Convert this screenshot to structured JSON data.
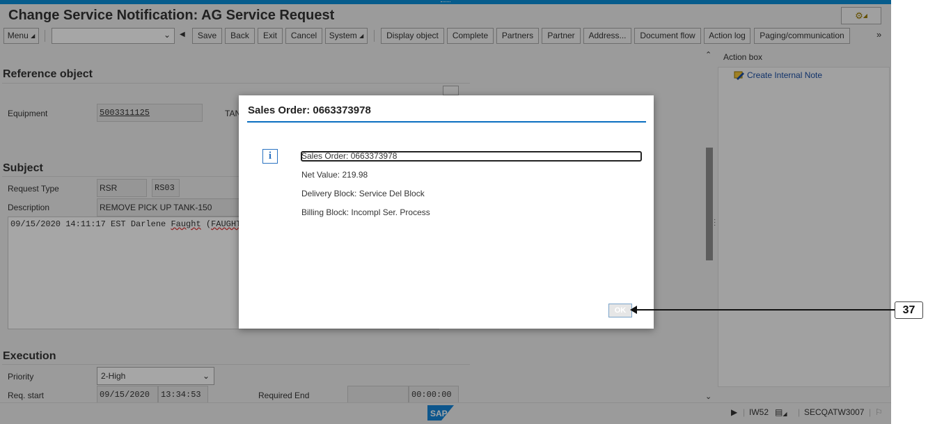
{
  "window": {
    "title": "Change Service Notification: AG Service Request"
  },
  "toolbar": {
    "menu_label": "Menu",
    "command_field_value": "",
    "save_label": "Save",
    "back_label": "Back",
    "exit_label": "Exit",
    "cancel_label": "Cancel",
    "system_label": "System",
    "display_object_label": "Display object",
    "complete_label": "Complete",
    "partners_label": "Partners",
    "partner_label": "Partner",
    "address_label": "Address...",
    "document_flow_label": "Document flow",
    "action_log_label": "Action log",
    "paging_label": "Paging/communication",
    "more_label": "»"
  },
  "reference_object": {
    "heading": "Reference object",
    "equipment_label": "Equipment",
    "equipment_value": "5003311125",
    "tank_label_partial": "TAN"
  },
  "subject": {
    "heading": "Subject",
    "request_type_label": "Request Type",
    "request_type_value": "RSR",
    "request_type_code": "RS03",
    "description_label": "Description",
    "description_value": "REMOVE PICK UP TANK-150",
    "longtext_prefix": "09/15/2020 14:11:17 EST Darlene ",
    "longtext_name": "Faught",
    "longtext_suffix": " (",
    "longtext_tail": "FAUGHT"
  },
  "execution": {
    "heading": "Execution",
    "priority_label": "Priority",
    "priority_value": "2-High",
    "req_start_label": "Req. start",
    "req_start_date": "09/15/2020",
    "req_start_time": "13:34:53",
    "required_end_label": "Required End",
    "required_end_date": "",
    "required_end_time": "00:00:00"
  },
  "action_box": {
    "heading": "Action box",
    "items": [
      {
        "label": "Create Internal Note"
      }
    ]
  },
  "statusbar": {
    "transaction": "IW52",
    "server": "SECQATW3007"
  },
  "dialog": {
    "title": "Sales Order: 0663373978",
    "lines": [
      "Sales Order: 0663373978",
      "Net Value: 219.98",
      "Delivery Block: Service Del Block",
      "Billing Block: Incompl Ser. Process"
    ],
    "ok_label": "OK"
  },
  "annotation": {
    "step_number": "37"
  },
  "colors": {
    "accent": "#0a8ed8",
    "link": "#1a4ea4",
    "dialog_rule": "#0a6ec0"
  }
}
